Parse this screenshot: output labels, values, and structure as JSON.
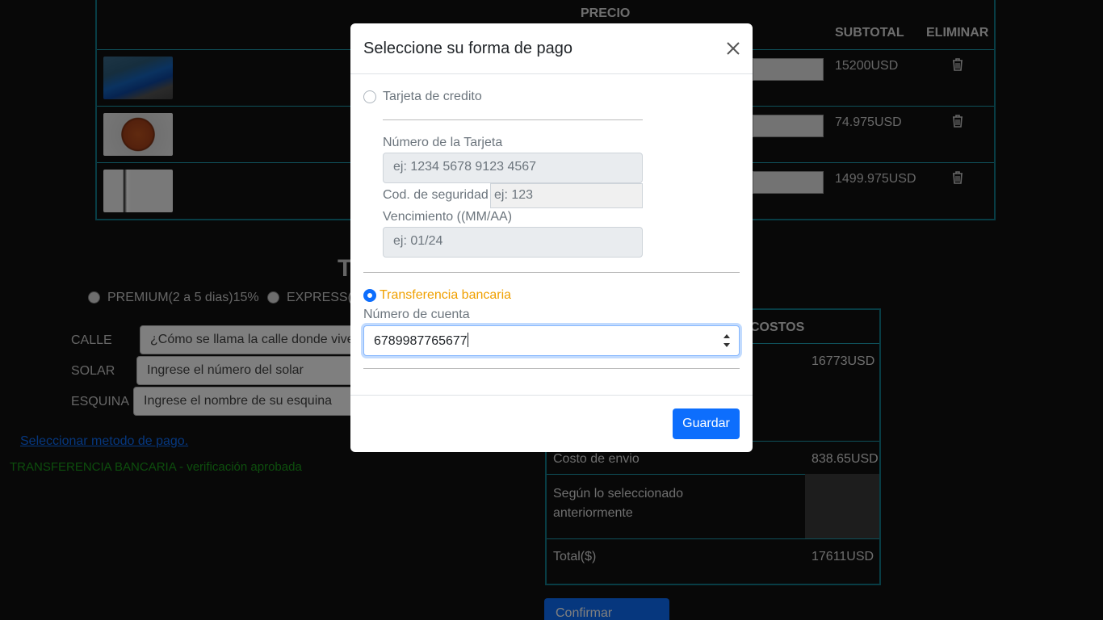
{
  "cart": {
    "headers": {
      "price": "PRECIO",
      "subtotal": "SUBTOTAL",
      "delete": "ELIMINAR"
    },
    "rows": [
      {
        "image": "car-image",
        "subtotal": "15200USD"
      },
      {
        "image": "basketball-image",
        "subtotal": "74.975USD"
      },
      {
        "image": "playstation-image",
        "subtotal": "1499.975USD"
      }
    ]
  },
  "shipping": {
    "heading_partial": "T",
    "options": [
      "PREMIUM(2 a 5 dias)15%",
      "EXPRESS(5"
    ],
    "fields": [
      {
        "label": "CALLE",
        "placeholder": "¿Cómo se llama la calle donde vives"
      },
      {
        "label": "SOLAR",
        "placeholder": "Ingrese el número del solar"
      },
      {
        "label": "ESQUINA",
        "placeholder": "Ingrese el nombre de su esquina"
      }
    ],
    "payment_link": "Seleccionar metodo de pago.",
    "payment_status": "TRANSFERENCIA BANCARIA - verificación aprobada"
  },
  "summary": {
    "header": "COSTOS",
    "subtotal_value": "16773USD",
    "shipping_label": "Costo de envio",
    "shipping_value": "838.65USD",
    "shipping_note": "Según lo seleccionado anteriormente",
    "total_label": "Total($)",
    "total_value": "17611USD",
    "confirm_button": "Confirmar compra"
  },
  "modal": {
    "title": "Seleccione su forma de pago",
    "credit_card_label": "Tarjeta de credito",
    "card_number_label": "Número de la Tarjeta",
    "card_number_placeholder": "ej: 1234 5678 9123 4567",
    "security_code_label": "Cod. de seguridad",
    "security_code_placeholder": "ej: 123",
    "expiry_label": "Vencimiento ((MM/AA)",
    "expiry_placeholder": "ej: 01/24",
    "bank_transfer_label": "Transferencia bancaria",
    "account_number_label": "Número de cuenta",
    "account_number_value": "6789987765677",
    "save_button": "Guardar"
  },
  "colors": {
    "accent": "#0d6efd",
    "teal_border": "#117a8b",
    "orange_label": "#f0a000",
    "success": "#1a9c1a"
  }
}
